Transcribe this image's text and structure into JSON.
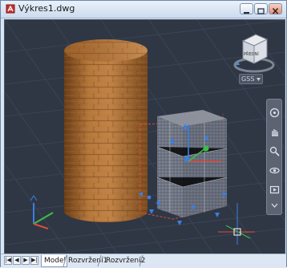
{
  "window": {
    "title": "Výkres1.dwg",
    "buttons": [
      "minimize",
      "restore",
      "close"
    ]
  },
  "viewport": {
    "viewcube_face_label": "PŘEDNÍ",
    "wcs_label": "GSS",
    "navigation_bar_tools": [
      "steering-wheel",
      "pan",
      "zoom",
      "orbit",
      "showmotion"
    ]
  },
  "layout_tabs": [
    {
      "label": "Model",
      "active": true
    },
    {
      "label": "Rozvržení1",
      "active": false
    },
    {
      "label": "Rozvržení2",
      "active": false
    }
  ],
  "colors": {
    "viewport_bg": "#2f3745",
    "wood": "#a4652a",
    "selection_dash": "#e04a3a",
    "grip_blue": "#3b7fe0"
  }
}
